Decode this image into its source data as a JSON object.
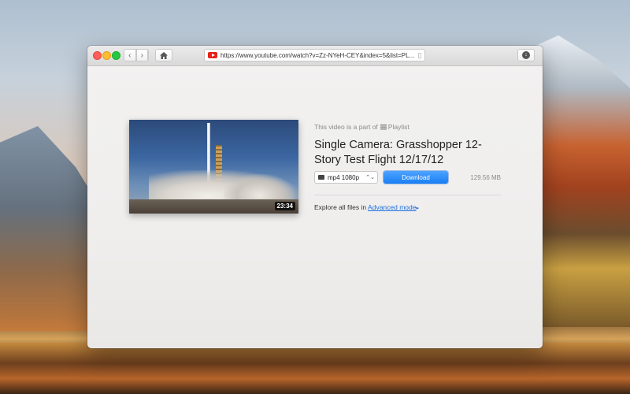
{
  "browser": {
    "url": "https://www.youtube.com/watch?v=Zz-NYeH-CEY&index=5&list=PL...",
    "back_icon": "chevron-left-icon",
    "forward_icon": "chevron-right-icon",
    "home_icon": "home-icon",
    "bookmark_icon": "bookmark-icon",
    "downloads_icon": "download-icon"
  },
  "video": {
    "playlist_prefix": "This video is a part of",
    "playlist_label": "Playlist",
    "title": "Single Camera: Grasshopper 12-Story Test Flight 12/17/12",
    "duration": "23:34"
  },
  "download": {
    "format": "mp4 1080p",
    "button_label": "Download",
    "size": "129.56 MB"
  },
  "footer": {
    "explore_text": "Explore all files in",
    "advanced_link": "Advanced mode",
    "advanced_arrow": "▸"
  },
  "colors": {
    "accent": "#1a7ef5",
    "youtube_red": "#e62117"
  }
}
